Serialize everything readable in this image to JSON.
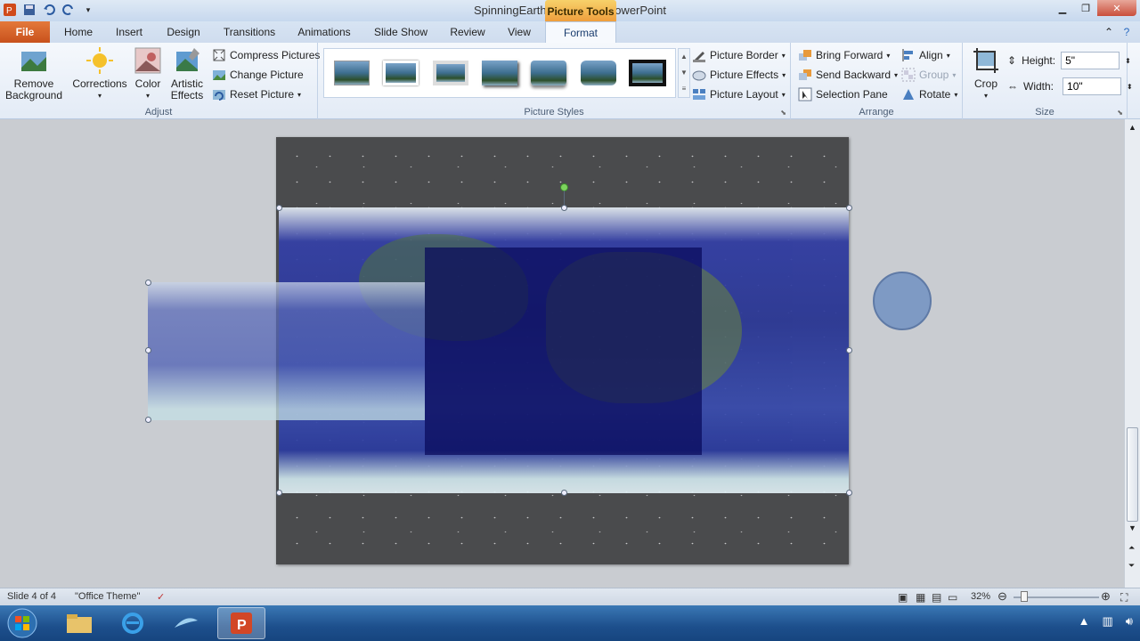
{
  "window": {
    "title": "SpinningEarth - Microsoft PowerPoint"
  },
  "contextual": {
    "label": "Picture Tools"
  },
  "tabs": [
    "File",
    "Home",
    "Insert",
    "Design",
    "Transitions",
    "Animations",
    "Slide Show",
    "Review",
    "View",
    "Format"
  ],
  "ribbon": {
    "adjust": {
      "label": "Adjust",
      "remove_bg": "Remove Background",
      "corrections": "Corrections",
      "color": "Color",
      "artistic": "Artistic Effects",
      "compress": "Compress Pictures",
      "change": "Change Picture",
      "reset": "Reset Picture"
    },
    "styles": {
      "label": "Picture Styles",
      "border": "Picture Border",
      "effects": "Picture Effects",
      "layout": "Picture Layout"
    },
    "arrange": {
      "label": "Arrange",
      "bring_forward": "Bring Forward",
      "send_backward": "Send Backward",
      "selection_pane": "Selection Pane",
      "align": "Align",
      "group": "Group",
      "rotate": "Rotate"
    },
    "size": {
      "label": "Size",
      "crop": "Crop",
      "height_label": "Height:",
      "height_value": "5\"",
      "width_label": "Width:",
      "width_value": "10\""
    }
  },
  "status": {
    "slide": "Slide 4 of 4",
    "theme": "\"Office Theme\"",
    "zoom": "32%"
  },
  "colors": {
    "file_tab": "#c8511c",
    "context_tab": "#ef9f3d",
    "taskbar": "#1d4f8c"
  }
}
